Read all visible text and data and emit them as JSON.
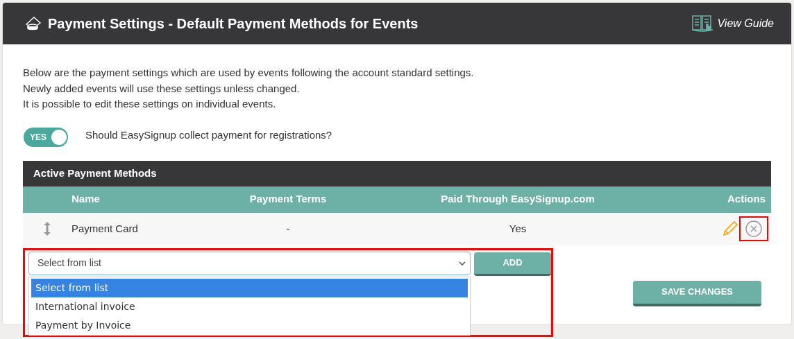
{
  "header": {
    "title": "Payment Settings - Default Payment Methods for Events",
    "guide_link": "View Guide"
  },
  "intro": [
    "Below are the payment settings which are used by events following the account standard settings.",
    "Newly added events will use these settings unless changed.",
    "It is possible to edit these settings on individual events."
  ],
  "collect_toggle": {
    "on": true,
    "label": "YES",
    "question": "Should EasySignup collect payment for registrations?"
  },
  "table": {
    "title": "Active Payment Methods",
    "columns": [
      "Name",
      "Payment Terms",
      "Paid Through EasySignup.com",
      "Actions"
    ],
    "rows": [
      {
        "name": "Payment Card",
        "payment_terms": "-",
        "paid_through": "Yes"
      }
    ]
  },
  "method_select": {
    "value": "Select from list",
    "expanded": true,
    "options": [
      {
        "label": "Select from list",
        "selected": true
      },
      {
        "label": "International invoice",
        "selected": false
      },
      {
        "label": "Payment by Invoice",
        "selected": false
      }
    ]
  },
  "add_button": "ADD",
  "save_button": "SAVE CHANGES"
}
